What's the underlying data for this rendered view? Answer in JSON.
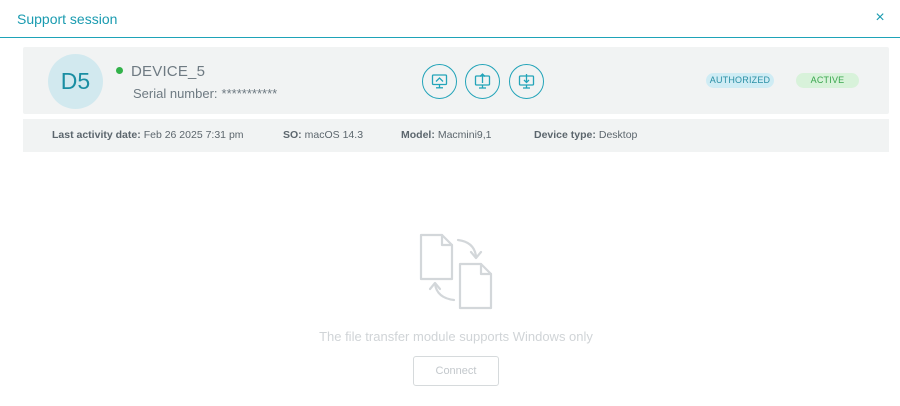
{
  "modal": {
    "title": "Support session",
    "close_glyph": "×"
  },
  "device": {
    "avatar_initials": "D5",
    "online_status_color": "#32b24a",
    "name": "DEVICE_5",
    "serial_label": "Serial number:",
    "serial_value": "***********",
    "actions": [
      {
        "icon": "remote-desktop-icon"
      },
      {
        "icon": "file-upload-icon"
      },
      {
        "icon": "file-download-icon"
      }
    ],
    "badges": {
      "authorized": "AUTHORIZED",
      "active": "ACTIVE"
    }
  },
  "info": {
    "last_activity_label": "Last activity date:",
    "last_activity_value": "Feb 26 2025 7:31 pm",
    "os_label": "SO:",
    "os_value": "macOS 14.3",
    "model_label": "Model:",
    "model_value": "Macmini9,1",
    "type_label": "Device type:",
    "type_value": "Desktop"
  },
  "file_transfer": {
    "icon": "file-transfer-icon",
    "message": "The file transfer module supports Windows only",
    "connect_label": "Connect"
  },
  "colors": {
    "accent": "#1a9bb0",
    "authorized_bg": "#cfecf4",
    "active_bg": "#d8f2da"
  }
}
